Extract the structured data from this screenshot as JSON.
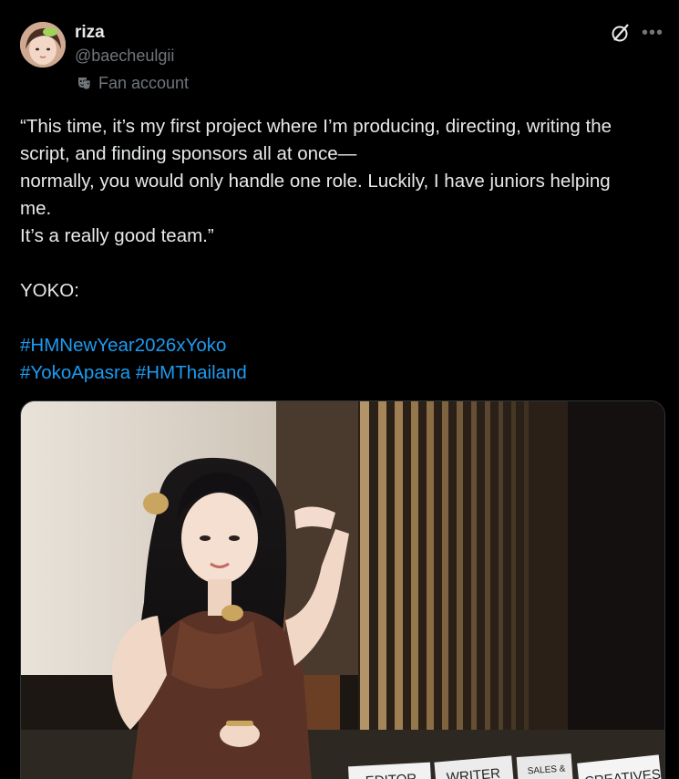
{
  "author": {
    "display_name": "riza",
    "handle": "@baecheulgii",
    "label": "Fan account"
  },
  "icons": {
    "label_icon": "theater-masks-icon",
    "grok": "grok-icon",
    "more": "more-options-icon"
  },
  "tweet": {
    "lines": [
      "“This time, it’s my first project where I’m producing, directing, writing the",
      "script, and finding sponsors all at once—",
      "normally, you would only handle one role. Luckily, I have juniors helping",
      "me.",
      "It’s a really good team.”",
      "YOKO:"
    ],
    "hashtags": [
      "#HMNewYear2026xYoko",
      "#YokoApasra",
      "#HMThailand"
    ]
  },
  "media": {
    "placards": [
      "EDITOR",
      "WRITER",
      "SALES &",
      "CREATIVES"
    ]
  },
  "colors": {
    "background": "#000000",
    "text": "#e7e9ea",
    "secondary": "#71767b",
    "link": "#1d9bf0"
  }
}
